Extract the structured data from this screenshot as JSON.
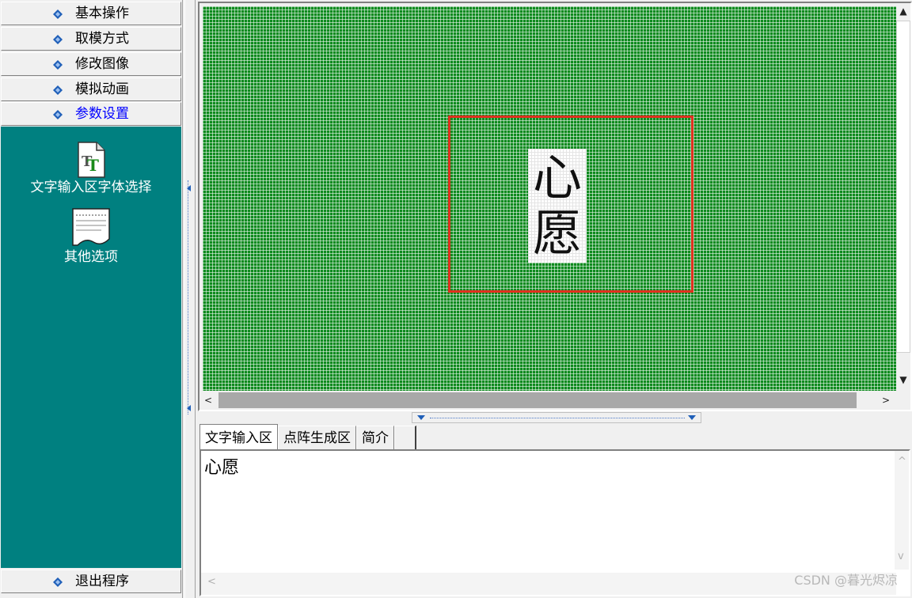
{
  "sidebar": {
    "nav_top": [
      {
        "label": "基本操作",
        "active": false
      },
      {
        "label": "取模方式",
        "active": false
      },
      {
        "label": "修改图像",
        "active": false
      },
      {
        "label": "模拟动画",
        "active": false
      },
      {
        "label": "参数设置",
        "active": true
      }
    ],
    "panel_items": [
      {
        "label": "文字输入区字体选择",
        "icon": "font-file-icon"
      },
      {
        "label": "其他选项",
        "icon": "options-document-icon"
      }
    ],
    "nav_bottom": {
      "label": "退出程序"
    }
  },
  "canvas": {
    "grid_color": "#0e8a1e",
    "frame_color": "#e0301e",
    "glyph_chars": [
      "心",
      "愿"
    ]
  },
  "tabs": [
    {
      "label": "文字输入区",
      "active": true
    },
    {
      "label": "点阵生成区",
      "active": false
    },
    {
      "label": "简介",
      "active": false
    }
  ],
  "editor": {
    "text": "心愿"
  },
  "watermark": "CSDN @暮光烬凉",
  "colors": {
    "panel_bg": "#008080",
    "active_nav": "#0000ff",
    "diamond": "#1f5fb8"
  }
}
